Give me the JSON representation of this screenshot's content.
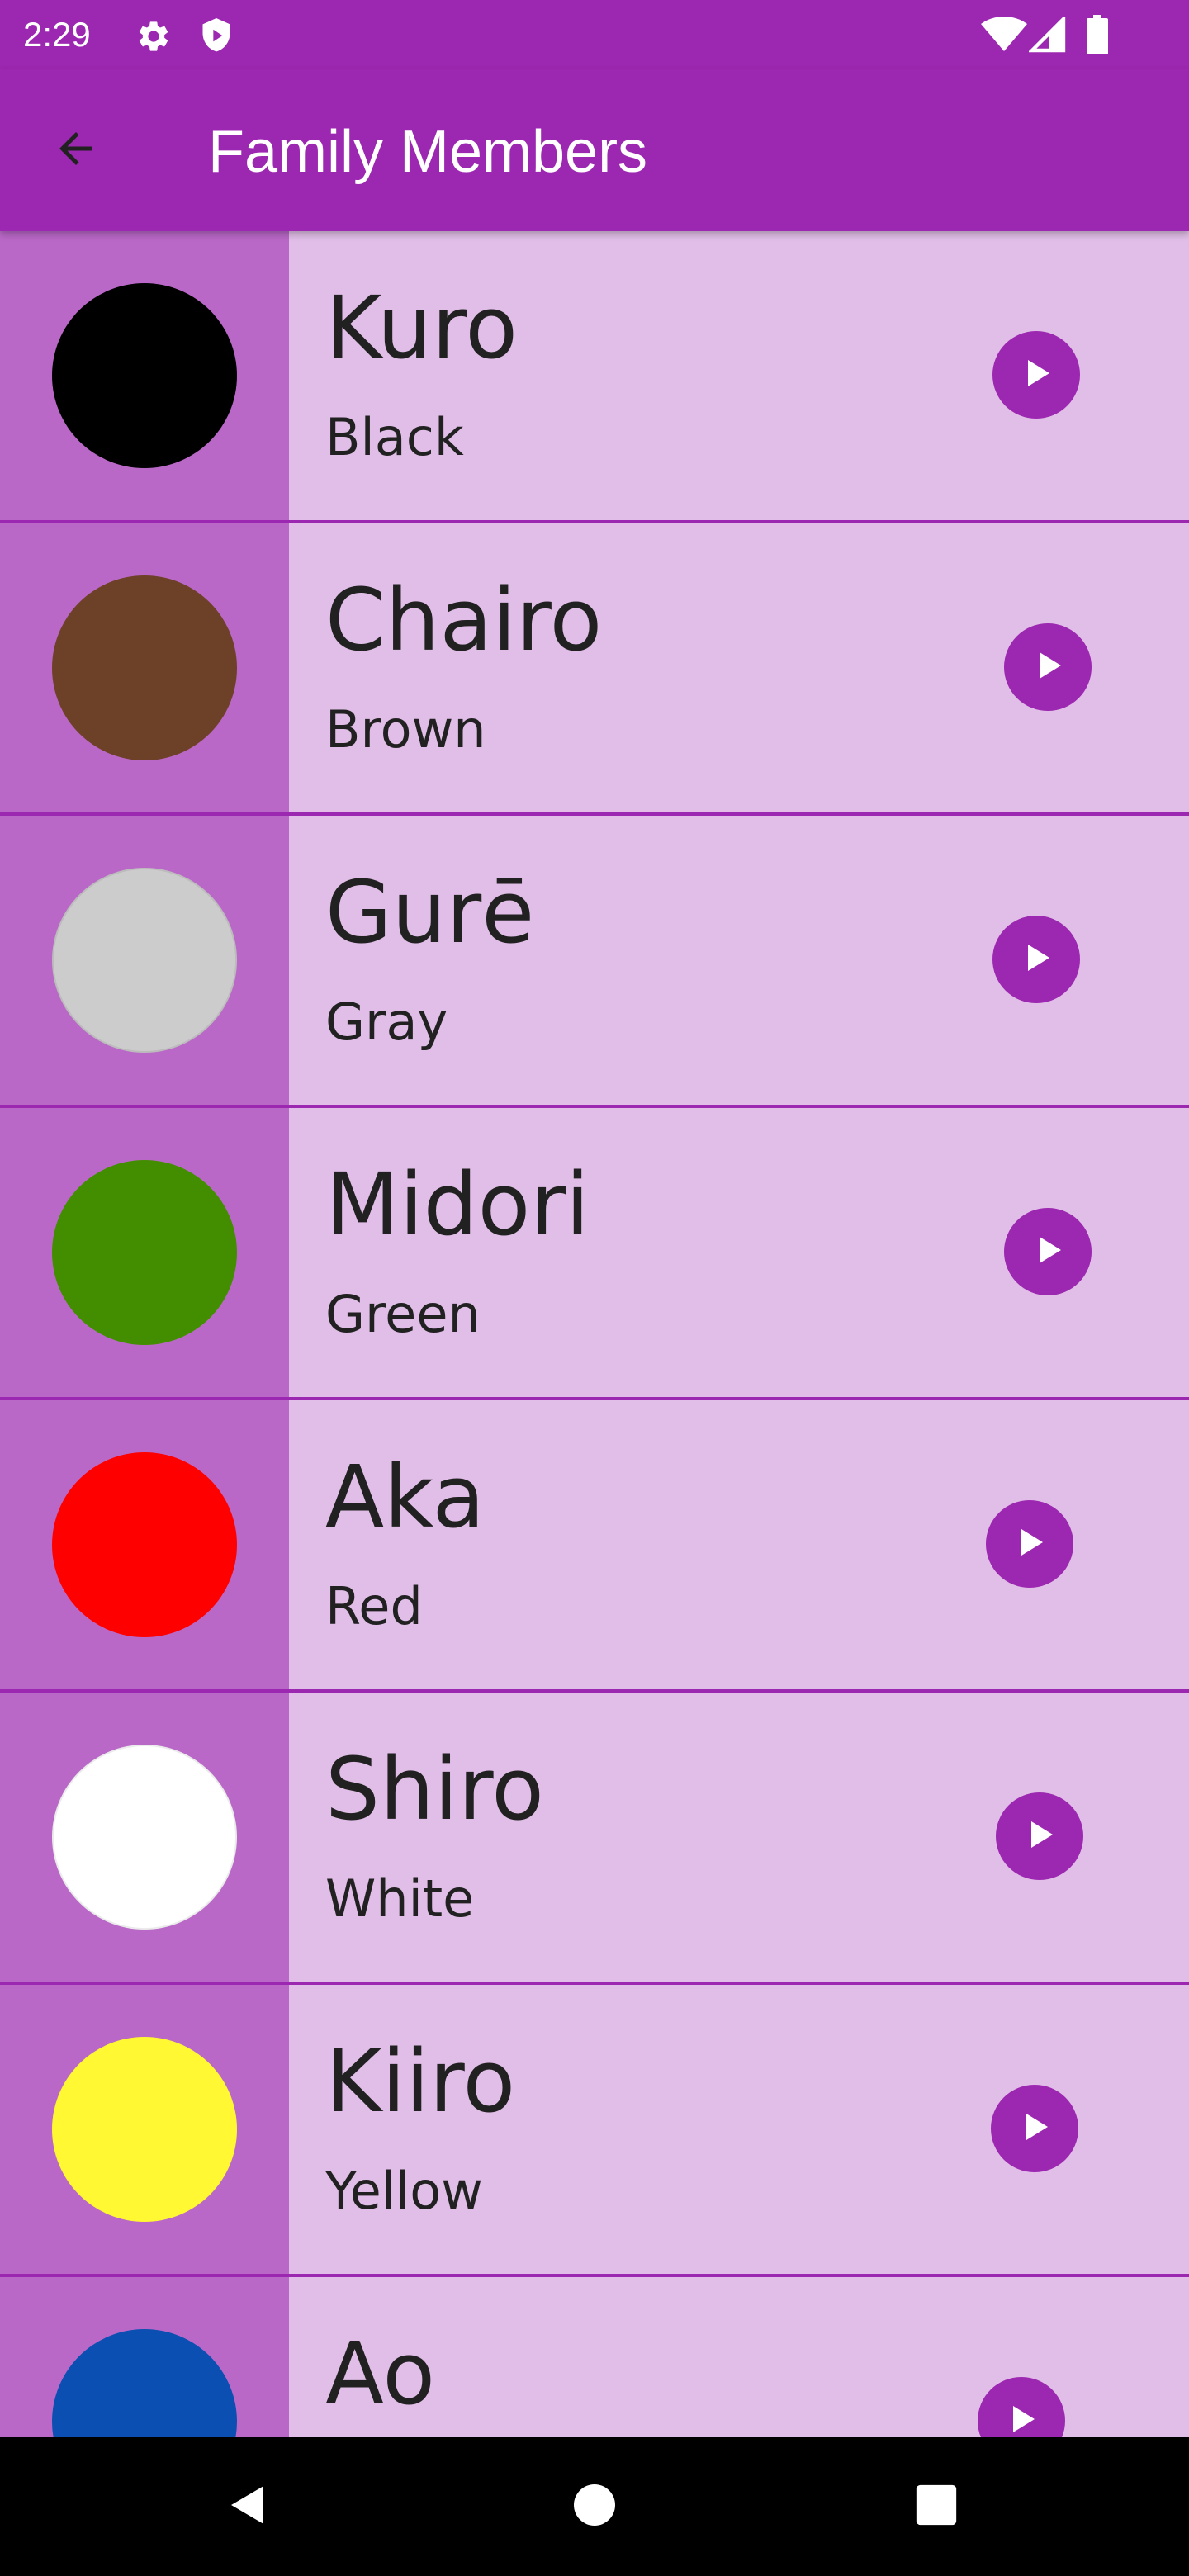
{
  "status_bar": {
    "time": "2:29",
    "icons": [
      "settings-icon",
      "shield-icon",
      "wifi-icon",
      "signal-icon",
      "battery-icon"
    ]
  },
  "app_bar": {
    "title": "Family Members",
    "back_icon": "arrow-back-icon"
  },
  "theme": {
    "primary": "#9c27b0",
    "list_background": "#e1bee7",
    "swatch_cell_background": "#ba68c8",
    "text": "#212121"
  },
  "items": [
    {
      "word": "Kuro",
      "translation": "Black",
      "color": "#000000"
    },
    {
      "word": "Chairo",
      "translation": "Brown",
      "color": "#6d4127"
    },
    {
      "word": "Gurē",
      "translation": "Gray",
      "color": "#cccccc"
    },
    {
      "word": "Midori",
      "translation": "Green",
      "color": "#438e00"
    },
    {
      "word": "Aka",
      "translation": "Red",
      "color": "#ff0000"
    },
    {
      "word": "Shiro",
      "translation": "White",
      "color": "#ffffff"
    },
    {
      "word": "Kiiro",
      "translation": "Yellow",
      "color": "#fff832"
    },
    {
      "word": "Ao",
      "translation": "",
      "color": "#0a4fb1"
    }
  ],
  "nav_bar": {
    "icons": [
      "nav-back-icon",
      "nav-home-icon",
      "nav-recents-icon"
    ]
  }
}
